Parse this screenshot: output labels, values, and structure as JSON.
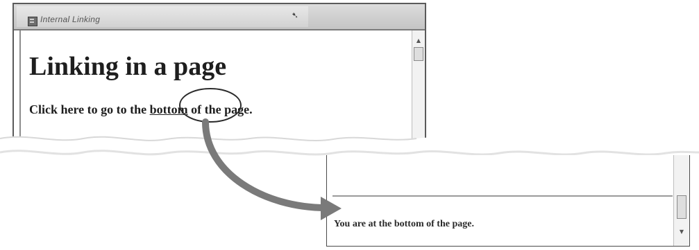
{
  "top_window": {
    "tab_title": "Internal Linking",
    "heading": "Linking in a page",
    "paragraph": {
      "before_link": "Click here to go to the ",
      "link_text": "bottom",
      "after_link": " of the page."
    },
    "tab_icon": "page-icon",
    "pointer_icon": "mouse-pointer-icon"
  },
  "bottom_window": {
    "text": "You are at the bottom of the page."
  },
  "callout": {
    "arrow_color": "#7a7a7a",
    "icon": "curved-arrow-icon"
  },
  "colors": {
    "text": "#1e1e1e",
    "titlebar": "#cfcfcf",
    "frame": "#5a5a5a"
  }
}
